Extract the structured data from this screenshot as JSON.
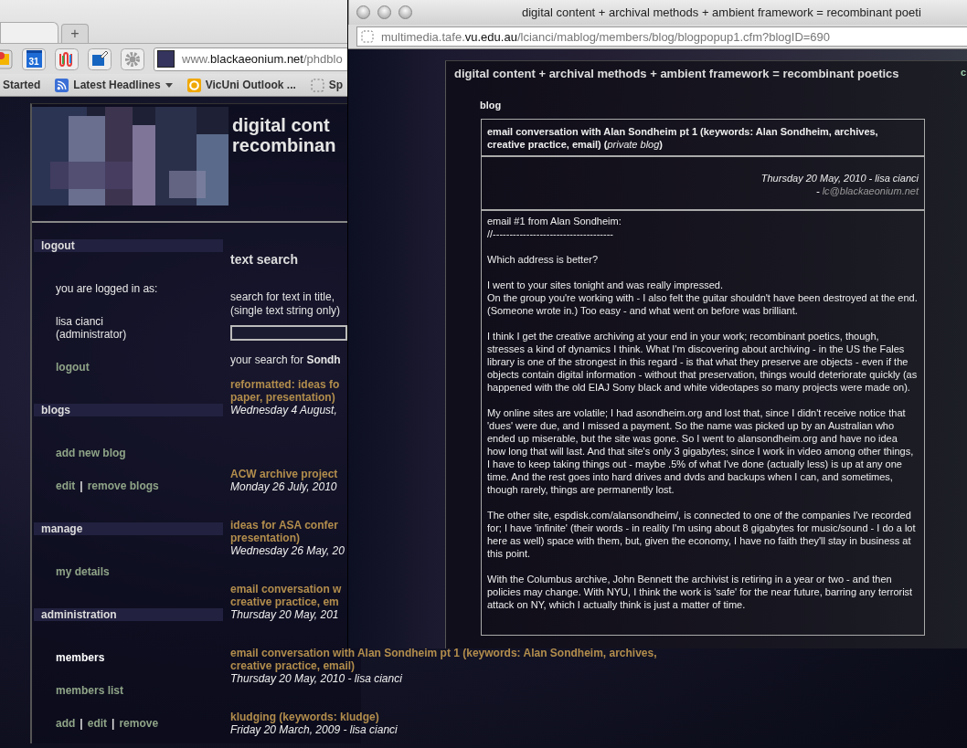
{
  "browser": {
    "new_tab_label": "+",
    "calendar_day": "31",
    "url": {
      "prefix": "www.",
      "domain": "blackaeonium.net",
      "path": "/phdblo"
    },
    "bookmarks": [
      {
        "kind": "text",
        "label": "Started"
      },
      {
        "kind": "feed",
        "label": "Latest Headlines"
      },
      {
        "kind": "mail",
        "label": "VicUni Outlook ..."
      },
      {
        "kind": "page",
        "label": "Sp"
      }
    ]
  },
  "site": {
    "title_lines": [
      "digital cont",
      "recombinan"
    ],
    "sidebar": [
      {
        "heading": "logout",
        "items": [
          {
            "kind": "text",
            "lines": [
              "you are logged in as:"
            ]
          },
          {
            "kind": "text",
            "lines": [
              "lisa cianci",
              "(administrator)"
            ]
          },
          {
            "kind": "links",
            "links": [
              "logout"
            ]
          }
        ]
      },
      {
        "heading": "blogs",
        "items": [
          {
            "kind": "links",
            "links": [
              "add new blog"
            ]
          },
          {
            "kind": "links",
            "links": [
              "edit",
              "remove blogs"
            ],
            "separator": "|"
          }
        ]
      },
      {
        "heading": "manage",
        "items": [
          {
            "kind": "links",
            "links": [
              "my details"
            ]
          }
        ]
      },
      {
        "heading": "administration",
        "items": [
          {
            "kind": "current",
            "lines": [
              "members"
            ]
          },
          {
            "kind": "links",
            "links": [
              "members list"
            ]
          },
          {
            "kind": "links",
            "links": [
              "add",
              "edit",
              "remove"
            ],
            "separator": "|"
          }
        ]
      }
    ],
    "search": {
      "heading": "text search",
      "prompt_lines": [
        "search for text in title,",
        "(single text string only)"
      ],
      "result_prefix": "your search for",
      "result_term": "Sondh",
      "results": [
        {
          "title_lines": [
            "reformatted: ideas fo",
            "paper, presentation)"
          ],
          "date": "Wednesday 4 August,"
        },
        {
          "title_lines": [
            "ACW archive project"
          ],
          "date": "Monday 26 July, 2010"
        },
        {
          "title_lines": [
            "ideas for ASA confer",
            "presentation)"
          ],
          "date": "Wednesday 26 May, 20"
        },
        {
          "title_lines": [
            "email conversation w",
            "creative practice, em"
          ],
          "date": "Thursday 20 May, 201"
        },
        {
          "title_lines": [
            "email conversation with Alan Sondheim pt 1 (keywords: Alan Sondheim, archives,",
            "creative practice, email)"
          ],
          "date": "Thursday 20 May, 2010 - lisa cianci"
        },
        {
          "title_lines": [
            "kludging (keywords: kludge)"
          ],
          "date": "Friday 20 March, 2009 - lisa cianci"
        }
      ]
    }
  },
  "popup": {
    "title": "digital content + archival methods + ambient framework = recombinant poeti",
    "url": {
      "prefix": "multimedia.tafe.",
      "domain": "vu.edu.au",
      "path": "/lcianci/mablog/members/blog/blogpopup1.cfm?blogID=690"
    },
    "page_title": "digital content + archival methods + ambient framework = recombinant poetics",
    "edge_letter": "c",
    "section_label": "blog",
    "post": {
      "title": "email conversation with Alan Sondheim pt 1 (keywords: Alan Sondheim, archives, creative practice, email) (*private blog*)",
      "date_line": "Thursday 20 May, 2010 - lisa cianci",
      "email_prefix": "-",
      "email": "lc@blackaeonium.net",
      "body": [
        "email #1 from Alan Sondheim:\n//------------------------------------",
        "Which address is better?",
        "I went to your sites tonight and was really impressed.\nOn the group you're working with - I also felt the guitar shouldn't have been destroyed at the end. (Someone wrote in.) Too easy - and what went on before was brilliant.",
        "I think I get the creative archiving at your end in your work; recombinant poetics, though, stresses a kind of dynamics I think. What I'm discovering about archiving - in the US the Fales library is one of the strongest in this regard - is that what they preserve are objects - even if the objects contain digital information - without that preservation, things would deteriorate quickly (as happened with the old EIAJ Sony black and white videotapes so many projects were made on).",
        "My online sites are volatile; I had asondheim.org and lost that, since I didn't receive notice that 'dues' were due, and I missed a payment. So the name was picked up by an Australian who ended up miserable, but the site was gone. So I went to alansondheim.org and have no idea how long that will last. And that site's only 3 gigabytes; since I work in video among other things, I have to keep taking things out - maybe .5% of what I've done (actually less) is up at any one time. And the rest goes into hard drives and dvds and backups when I can, and sometimes, though rarely, things are permanently lost.",
        "The other site, espdisk.com/alansondheim/, is connected to one of the companies I've recorded for; I have 'infinite' (their words - in reality I'm using about 8 gigabytes for music/sound - I do a lot here as well) space with them, but, given the economy, I have no faith they'll stay in business at this point.",
        "With the Columbus archive, John Bennett the archivist is retiring in a year or two - and then policies may change. With NYU, I think the work is 'safe' for the near future, barring any terrorist attack on NY, which I actually think is just a matter of time."
      ]
    }
  }
}
